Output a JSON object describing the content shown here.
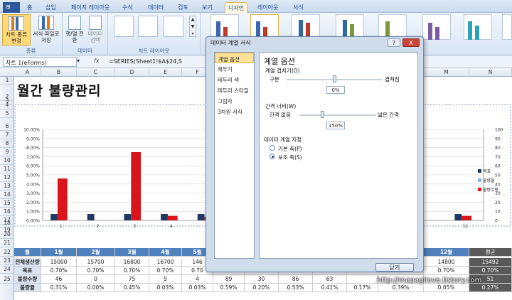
{
  "ribbon": {
    "tabs": [
      "홈",
      "삽입",
      "페이지 레이아웃",
      "수식",
      "데이터",
      "검토",
      "보기",
      "디자인",
      "레이아웃",
      "서식"
    ],
    "active_tab": "디자인",
    "groups": {
      "type": {
        "label": "종류",
        "buttons": [
          "차트 종류 변경",
          "서식 파일로 저장"
        ]
      },
      "data": {
        "label": "데이터",
        "buttons": [
          "행/열 전환",
          "데이터 선택"
        ]
      },
      "layouts": {
        "label": "차트 레이아웃"
      }
    }
  },
  "formula_bar": {
    "name_box": "차트 1(eForms)",
    "fx": "fx",
    "formula": "=SERIES(Sheet1!$A$24,S"
  },
  "sheet": {
    "columns": [
      "A",
      "B",
      "C",
      "D",
      "E",
      "F",
      "G",
      "H",
      "I",
      "J",
      "K",
      "L",
      "M",
      "N"
    ],
    "rows": [
      "1",
      "2",
      "3",
      "4",
      "5",
      "6",
      "7",
      "8",
      "9",
      "10",
      "11",
      "12",
      "13",
      "14",
      "15",
      "16",
      "17",
      "18",
      "19",
      "20",
      "21",
      "22",
      "23",
      "24",
      "25"
    ],
    "title": "월간 불량관리",
    "table": {
      "header": [
        "월",
        "1월",
        "2월",
        "3월",
        "4월",
        "5월",
        "",
        "",
        "",
        "",
        "",
        "",
        "12월",
        "평균"
      ],
      "rows": [
        {
          "label": "전체생산량",
          "cells": [
            "15000",
            "15700",
            "16800",
            "16700",
            "146",
            "",
            "",
            "",
            "",
            "",
            "",
            "14800",
            "15492"
          ]
        },
        {
          "label": "목표",
          "cells": [
            "0.70%",
            "0.70%",
            "0.70%",
            "0.70%",
            "0.70",
            "",
            "",
            "",
            "",
            "",
            "",
            "0.70%",
            "0.70%"
          ]
        },
        {
          "label": "불량수량",
          "cells": [
            "46",
            "0",
            "75",
            "5",
            "4",
            "89",
            "30",
            "86",
            "63",
            "",
            "",
            "",
            "51"
          ]
        },
        {
          "label": "불량율",
          "cells": [
            "0.31%",
            "0.00%",
            "0.45%",
            "0.03%",
            "0.03%",
            "0.59%",
            "0.20%",
            "0.53%",
            "0.41%",
            "0.17%",
            "0.39%",
            "0.05%",
            "0.27%"
          ]
        }
      ]
    }
  },
  "chart_data": {
    "type": "bar",
    "categories": [
      "1",
      "2",
      "3",
      "4",
      "5",
      "6",
      "7",
      "8",
      "9",
      "10",
      "11",
      "12"
    ],
    "y_left": {
      "ticks": [
        "0.00%",
        "1.00%",
        "2.00%",
        "3.00%",
        "4.00%",
        "5.00%",
        "6.00%",
        "7.00%",
        "8.00%",
        "9.00%",
        "10.00%"
      ],
      "ylim": [
        0,
        10
      ]
    },
    "y_right": {
      "ticks": [
        "0",
        "10",
        "20",
        "30",
        "40",
        "50",
        "60",
        "70",
        "80",
        "90",
        "100"
      ],
      "ylim": [
        0,
        100
      ]
    },
    "legend_position": "right",
    "series": [
      {
        "name": "목표",
        "color": "#1f3864",
        "axis": "left",
        "values": [
          0.7,
          0.7,
          0.7,
          0.7,
          0.7,
          0.7,
          0.7,
          0.7,
          0.7,
          0.7,
          0.7,
          0.7
        ]
      },
      {
        "name": "불량율",
        "color": "#8db3e2",
        "axis": "left",
        "values": [
          0.31,
          0.0,
          0.45,
          0.03,
          0.03,
          0.59,
          0.2,
          0.53,
          0.41,
          0.17,
          0.39,
          0.05
        ]
      },
      {
        "name": "불량수량",
        "color": "#d9141a",
        "axis": "right",
        "values": [
          46,
          0,
          75,
          5,
          4,
          89,
          30,
          86,
          63,
          12,
          20,
          5
        ]
      }
    ],
    "visible_category_indices": [
      0,
      1,
      2,
      3,
      4,
      11
    ]
  },
  "dialog": {
    "title": "데이터 계열 서식",
    "help": "?",
    "close": "X",
    "nav": [
      "계열 옵션",
      "채우기",
      "테두리 색",
      "테두리 스타일",
      "그림자",
      "3차원 서식"
    ],
    "selected_nav": "계열 옵션",
    "heading": "계열 옵션",
    "overlap": {
      "label": "계열 겹치기(O)",
      "left": "구분",
      "right": "겹쳐짐",
      "value": "0%",
      "level": 0.5
    },
    "gap": {
      "label": "간격 너비(W)",
      "left": "간격 없음",
      "right": "넓은 간격",
      "value": "150%",
      "level": 0.3
    },
    "axis": {
      "label": "데이터 계열 지정",
      "options": [
        "기본 축(P)",
        "보조 축(S)"
      ],
      "selected": "보조 축(S)"
    },
    "close_button": "닫기"
  },
  "watermark": "http://mapagilove.tistory.com"
}
